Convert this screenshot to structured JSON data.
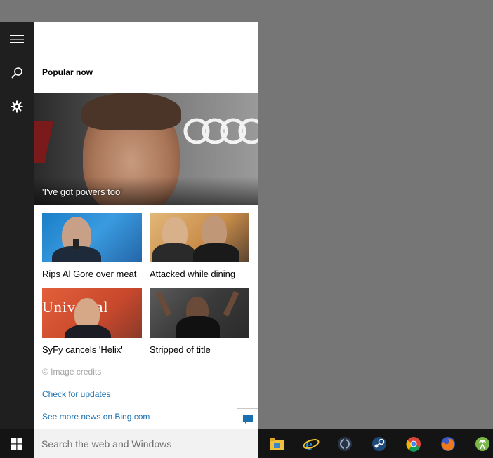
{
  "window": {
    "section_title": "Popular now"
  },
  "hero": {
    "caption": "'I've got powers too'"
  },
  "tiles": [
    {
      "label": "Rips Al Gore over meat"
    },
    {
      "label": "Attacked while dining"
    },
    {
      "label": "SyFy cancels 'Helix'"
    },
    {
      "label": "Stripped of title"
    }
  ],
  "footer": {
    "credits": "© Image credits",
    "check_updates": "Check for updates",
    "see_more": "See more news on Bing.com"
  },
  "taskbar": {
    "search_placeholder": "Search the web and Windows",
    "pinned": [
      "file-explorer-icon",
      "internet-explorer-icon",
      "steam-client-icon",
      "steam-icon",
      "chrome-icon",
      "firefox-icon",
      "android-studio-icon"
    ]
  },
  "colors": {
    "rail": "#1f1f1f",
    "taskbar": "#141414",
    "link": "#1a6fb0",
    "desktop": "#767676"
  }
}
